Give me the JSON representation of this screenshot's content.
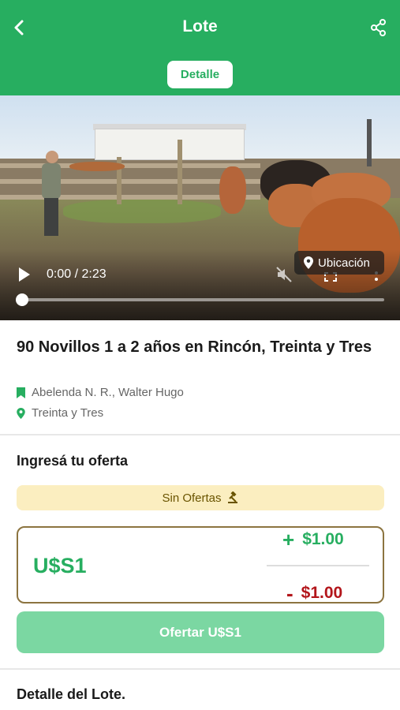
{
  "header": {
    "title": "Lote",
    "tab_label": "Detalle",
    "bg_color": "#27ae60",
    "back_icon": "chevron-left-icon",
    "share_icon": "share-icon"
  },
  "video": {
    "time": "0:00 / 2:23",
    "progress": 0,
    "location_button": "Ubicación"
  },
  "lot": {
    "title": "90 Novillos 1 a 2 años en Rincón, Treinta y Tres",
    "seller": "Abelenda N. R., Walter Hugo",
    "location": "Treinta y Tres"
  },
  "offer": {
    "heading": "Ingresá tu oferta",
    "status": "Sin Ofertas",
    "amount": "U$S1",
    "increment": "$1.00",
    "decrement": "$1.00",
    "increment_sign": "+",
    "decrement_sign": "-",
    "submit_label": "Ofertar U$S1"
  },
  "detail": {
    "heading": "Detalle del Lote."
  }
}
